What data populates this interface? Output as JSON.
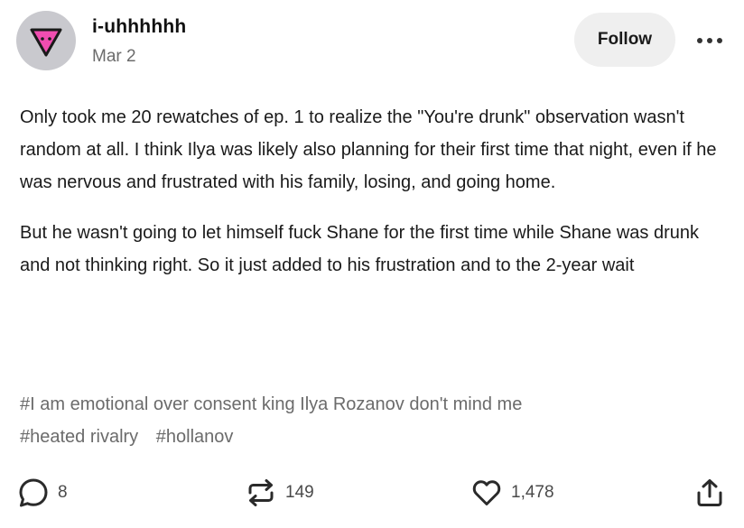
{
  "post": {
    "author": "i-uhhhhhh",
    "date": "Mar 2",
    "follow_label": "Follow",
    "more_icon": "more-dots-icon",
    "paragraphs": [
      "Only took me 20 rewatches of ep. 1 to realize the \"You're drunk\" observation wasn't random at all. I think Ilya was likely also planning for their first time that night, even if he was nervous and frustrated with his family, losing, and going home.",
      "But he wasn't going to let himself fuck Shane for the first time while Shane was drunk and not thinking right. So it just added to his frustration and to the 2-year wait"
    ],
    "tags": [
      "#I am emotional over consent king Ilya Rozanov don't mind me",
      "#heated rivalry",
      "#hollanov"
    ]
  },
  "footer": {
    "comments": "8",
    "reblogs": "149",
    "likes": "1,478"
  },
  "colors": {
    "avatar_bg": "#c9c9ce",
    "avatar_icon": "#f04db0",
    "follow_bg": "#efefef",
    "tag_text": "#6b6b6b"
  }
}
